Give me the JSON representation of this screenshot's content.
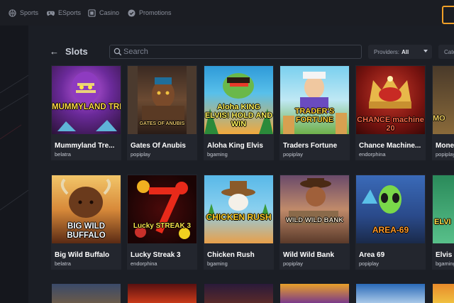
{
  "nav": {
    "items": [
      {
        "label": "Sports",
        "icon": "sports-ball-icon"
      },
      {
        "label": "ESports",
        "icon": "gamepad-icon"
      },
      {
        "label": "Casino",
        "icon": "casino-card-icon"
      },
      {
        "label": "Promotions",
        "icon": "promotions-check-icon"
      }
    ]
  },
  "header": {
    "title": "Slots",
    "search_placeholder": "Search",
    "providers_label": "Providers:",
    "providers_value": "All",
    "categories_label": "Cate"
  },
  "colors": {
    "accent": "#f0a028",
    "card_bg": "#23262e",
    "page_bg": "#15171d"
  },
  "games": [
    {
      "title": "Mummyland Tre...",
      "provider": "belatra",
      "art_text": "MUMMYLAND TREASURES"
    },
    {
      "title": "Gates Of Anubis",
      "provider": "popiplay",
      "art_text": "GATES OF ANUBIS"
    },
    {
      "title": "Aloha King Elvis",
      "provider": "bgaming",
      "art_text": "Aloha KING ELVIS! HOLD AND WIN"
    },
    {
      "title": "Traders Fortune",
      "provider": "popiplay",
      "art_text": "TRADER'S FORTUNE"
    },
    {
      "title": "Chance Machine...",
      "provider": "endorphina",
      "art_text": "CHANCE machine 20"
    },
    {
      "title": "Mone",
      "provider": "popiplay",
      "art_text": "MO"
    },
    {
      "title": "Big Wild Buffalo",
      "provider": "belatra",
      "art_text": "BIG WILD BUFFALO"
    },
    {
      "title": "Lucky Streak 3",
      "provider": "endorphina",
      "art_text": "Lucky STREAK 3"
    },
    {
      "title": "Chicken Rush",
      "provider": "bgaming",
      "art_text": "CHICKEN RUSH"
    },
    {
      "title": "Wild Wild Bank",
      "provider": "popiplay",
      "art_text": "WILD WILD BANK"
    },
    {
      "title": "Area 69",
      "provider": "popiplay",
      "art_text": "AREA-69"
    },
    {
      "title": "Elvis",
      "provider": "bgaming",
      "art_text": "ELVI"
    }
  ]
}
